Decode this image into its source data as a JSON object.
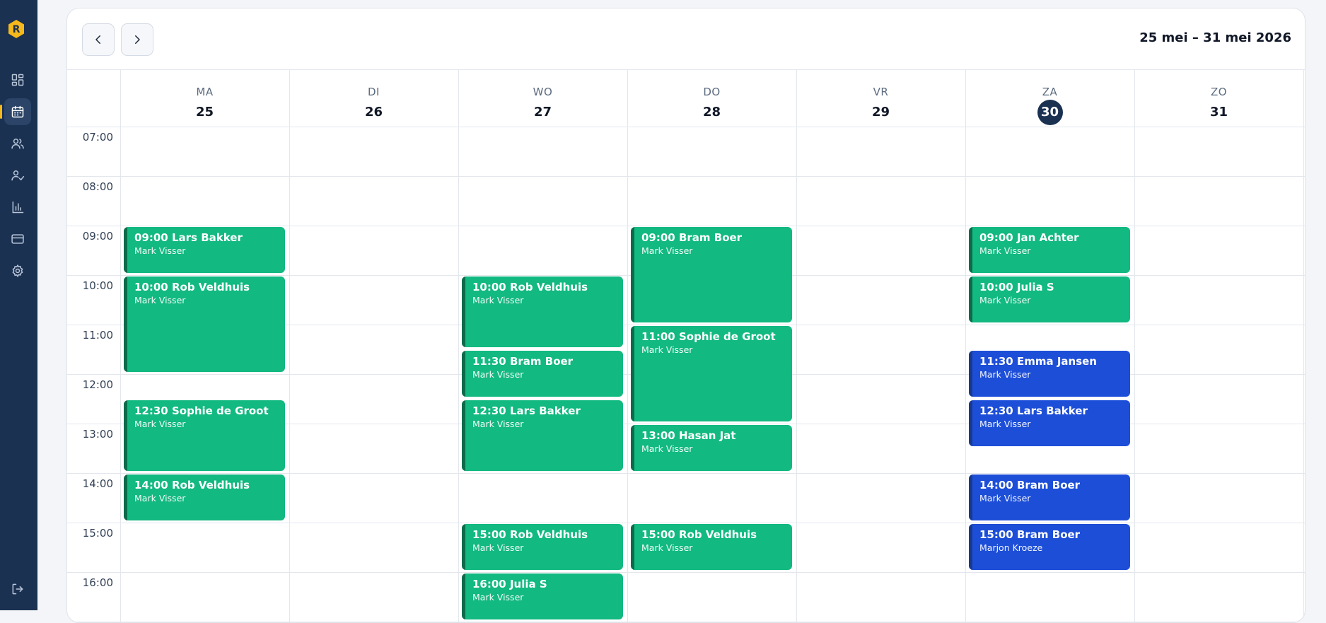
{
  "app": {
    "logo_letter": "R",
    "accent": "#f5b91c",
    "sidebar_bg": "#1b3152"
  },
  "sidebar": {
    "items": [
      {
        "name": "dashboard",
        "icon": "dashboard-icon",
        "active": false
      },
      {
        "name": "calendar",
        "icon": "calendar-icon",
        "active": true
      },
      {
        "name": "clients",
        "icon": "users-icon",
        "active": false
      },
      {
        "name": "staff",
        "icon": "user-check-icon",
        "active": false
      },
      {
        "name": "reports",
        "icon": "bar-chart-icon",
        "active": false
      },
      {
        "name": "payments",
        "icon": "credit-card-icon",
        "active": false
      },
      {
        "name": "settings",
        "icon": "gear-icon",
        "active": false
      }
    ],
    "logout_icon": "logout-icon"
  },
  "toolbar": {
    "prev_icon": "chevron-left-icon",
    "next_icon": "chevron-right-icon",
    "date_range": "25 mei – 31 mei 2026"
  },
  "days": [
    {
      "name": "MA",
      "num": "25",
      "today": false
    },
    {
      "name": "DI",
      "num": "26",
      "today": false
    },
    {
      "name": "WO",
      "num": "27",
      "today": false
    },
    {
      "name": "DO",
      "num": "28",
      "today": false
    },
    {
      "name": "VR",
      "num": "29",
      "today": false
    },
    {
      "name": "ZA",
      "num": "30",
      "today": true
    },
    {
      "name": "ZO",
      "num": "31",
      "today": false
    }
  ],
  "times": [
    "07:00",
    "08:00",
    "09:00",
    "10:00",
    "11:00",
    "12:00",
    "13:00",
    "14:00",
    "15:00",
    "16:00"
  ],
  "colors": {
    "green": "#12b981",
    "blue": "#1d4ed8"
  },
  "events": [
    {
      "day": 0,
      "start": "09:00",
      "duration_min": 60,
      "title": "09:00 Lars Bakker",
      "staff": "Mark Visser",
      "color": "green"
    },
    {
      "day": 0,
      "start": "10:00",
      "duration_min": 120,
      "title": "10:00 Rob Veldhuis",
      "staff": "Mark Visser",
      "color": "green"
    },
    {
      "day": 0,
      "start": "12:30",
      "duration_min": 90,
      "title": "12:30 Sophie de Groot",
      "staff": "Mark Visser",
      "color": "green"
    },
    {
      "day": 0,
      "start": "14:00",
      "duration_min": 60,
      "title": "14:00 Rob Veldhuis",
      "staff": "Mark Visser",
      "color": "green"
    },
    {
      "day": 2,
      "start": "10:00",
      "duration_min": 90,
      "title": "10:00 Rob Veldhuis",
      "staff": "Mark Visser",
      "color": "green"
    },
    {
      "day": 2,
      "start": "11:30",
      "duration_min": 60,
      "title": "11:30 Bram Boer",
      "staff": "Mark Visser",
      "color": "green"
    },
    {
      "day": 2,
      "start": "12:30",
      "duration_min": 90,
      "title": "12:30 Lars Bakker",
      "staff": "Mark Visser",
      "color": "green"
    },
    {
      "day": 2,
      "start": "15:00",
      "duration_min": 60,
      "title": "15:00 Rob Veldhuis",
      "staff": "Mark Visser",
      "color": "green"
    },
    {
      "day": 2,
      "start": "16:00",
      "duration_min": 60,
      "title": "16:00 Julia S",
      "staff": "Mark Visser",
      "color": "green"
    },
    {
      "day": 3,
      "start": "09:00",
      "duration_min": 120,
      "title": "09:00 Bram Boer",
      "staff": "Mark Visser",
      "color": "green"
    },
    {
      "day": 3,
      "start": "11:00",
      "duration_min": 120,
      "title": "11:00 Sophie de Groot",
      "staff": "Mark Visser",
      "color": "green"
    },
    {
      "day": 3,
      "start": "13:00",
      "duration_min": 60,
      "title": "13:00 Hasan Jat",
      "staff": "Mark Visser",
      "color": "green"
    },
    {
      "day": 3,
      "start": "15:00",
      "duration_min": 60,
      "title": "15:00 Rob Veldhuis",
      "staff": "Mark Visser",
      "color": "green"
    },
    {
      "day": 5,
      "start": "09:00",
      "duration_min": 60,
      "title": "09:00 Jan Achter",
      "staff": "Mark Visser",
      "color": "green"
    },
    {
      "day": 5,
      "start": "10:00",
      "duration_min": 60,
      "title": "10:00 Julia S",
      "staff": "Mark Visser",
      "color": "green"
    },
    {
      "day": 5,
      "start": "11:30",
      "duration_min": 60,
      "title": "11:30 Emma Jansen",
      "staff": "Mark Visser",
      "color": "blue"
    },
    {
      "day": 5,
      "start": "12:30",
      "duration_min": 60,
      "title": "12:30 Lars Bakker",
      "staff": "Mark Visser",
      "color": "blue"
    },
    {
      "day": 5,
      "start": "14:00",
      "duration_min": 60,
      "title": "14:00 Bram Boer",
      "staff": "Mark Visser",
      "color": "blue"
    },
    {
      "day": 5,
      "start": "15:00",
      "duration_min": 60,
      "title": "15:00 Bram Boer",
      "staff": "Marjon Kroeze",
      "color": "blue"
    }
  ]
}
